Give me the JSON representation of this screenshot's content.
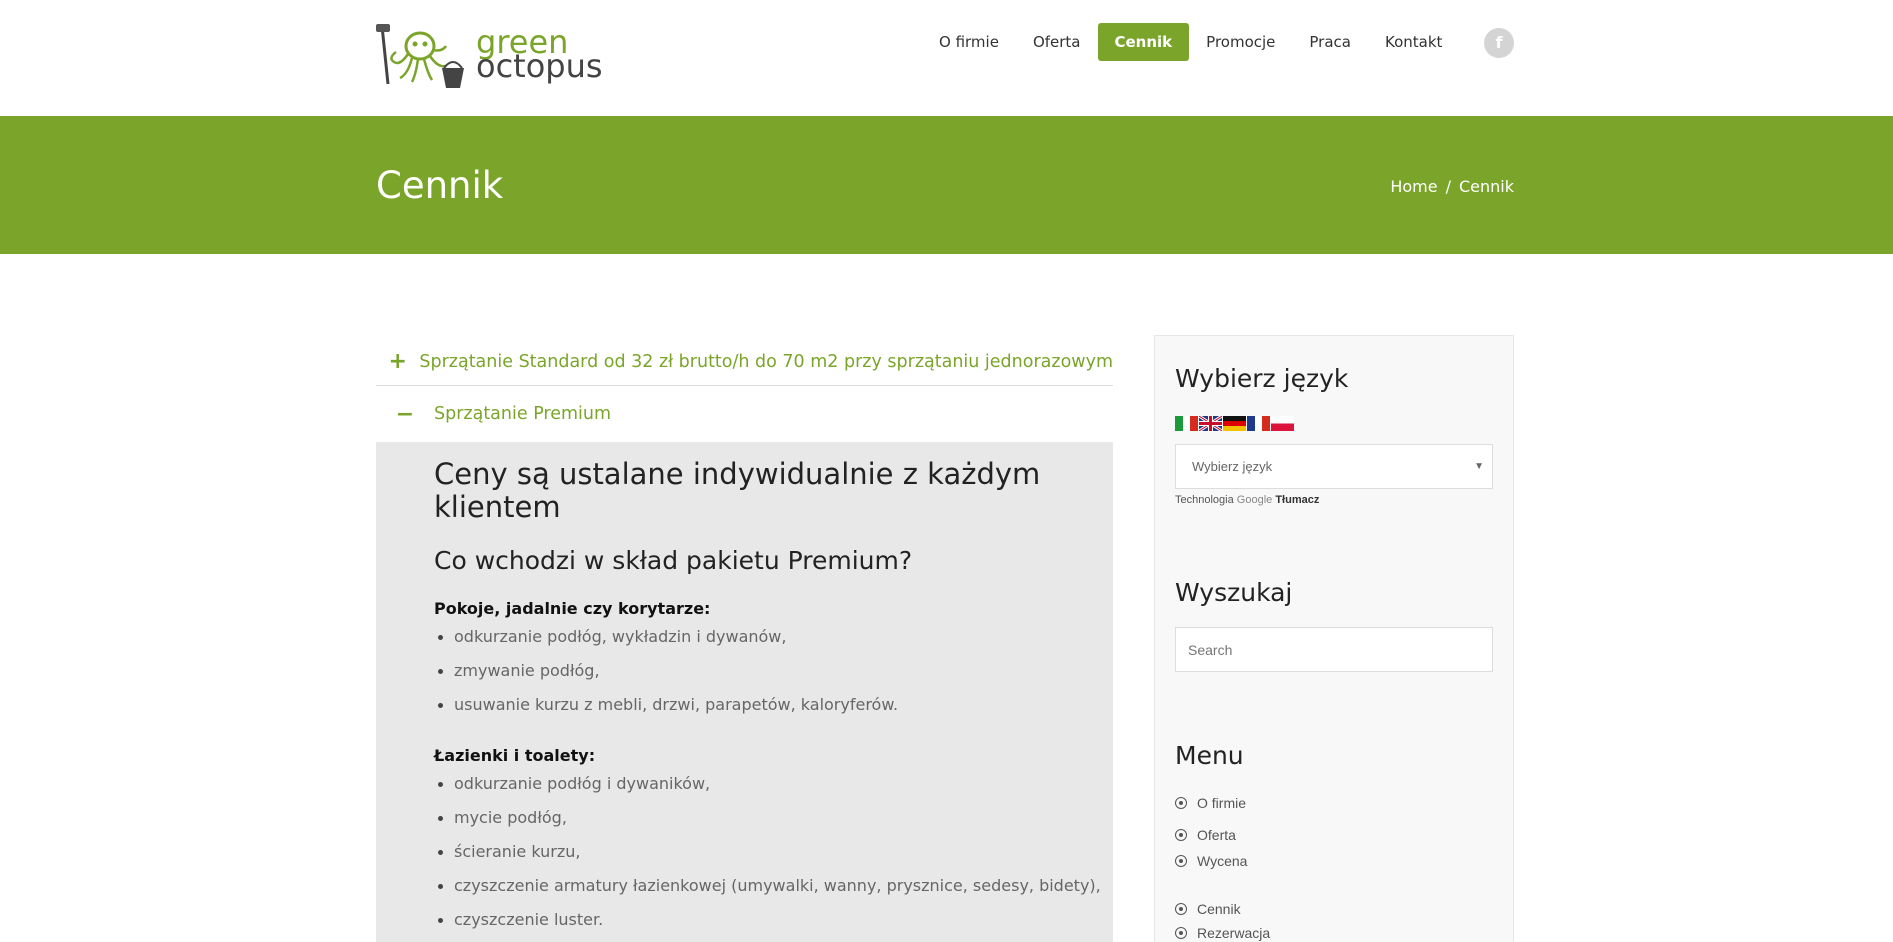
{
  "header": {
    "logo_top": "green",
    "logo_bottom": "octopus",
    "nav": [
      {
        "label": "O firmie"
      },
      {
        "label": "Oferta"
      },
      {
        "label": "Cennik"
      },
      {
        "label": "Promocje"
      },
      {
        "label": "Praca"
      },
      {
        "label": "Kontakt"
      }
    ],
    "active_nav": "Cennik",
    "facebook_glyph": "f"
  },
  "titlebar": {
    "title": "Cennik",
    "breadcrumb_home": "Home",
    "breadcrumb_sep": "/",
    "breadcrumb_current": "Cennik"
  },
  "accordion": {
    "collapsed_sign": "+",
    "expanded_sign": "−",
    "item1_label": "Sprzątanie Standard od 32 zł brutto/h do 70 m2 przy sprzątaniu jednorazowym",
    "item2_label": "Sprzątanie Premium",
    "heading": "Ceny są ustalane indywidualnie z każdym klientem",
    "subheading": "Co wchodzi w skład pakietu Premium?",
    "section1_title": "Pokoje, jadalnie czy korytarze:",
    "section1_items": [
      "odkurzanie podłóg, wykładzin i dywanów,",
      "zmywanie podłóg,",
      "usuwanie kurzu z mebli, drzwi, parapetów, kaloryferów."
    ],
    "section2_title": "Łazienki i toalety:",
    "section2_items": [
      "odkurzanie podłóg i dywaników,",
      "mycie podłóg,",
      "ścieranie kurzu,",
      "czyszczenie armatury łazienkowej (umywalki, wanny, prysznice, sedesy, bidety),",
      "czyszczenie luster."
    ]
  },
  "sidebar": {
    "language_title": "Wybierz język",
    "language_select": "Wybierz język",
    "select_arrow": "▼",
    "powered_prefix": "Technologia",
    "powered_google": "Google",
    "powered_suffix": "Tłumacz",
    "search_title": "Wyszukaj",
    "search_placeholder": "Search",
    "menu_title": "Menu",
    "menu_items": [
      "O firmie",
      "Oferta",
      "Wycena",
      "Cennik",
      "Rezerwacja"
    ]
  },
  "colors": {
    "brand_green": "#7aa52a",
    "panel_gray": "#e8e8e8"
  }
}
